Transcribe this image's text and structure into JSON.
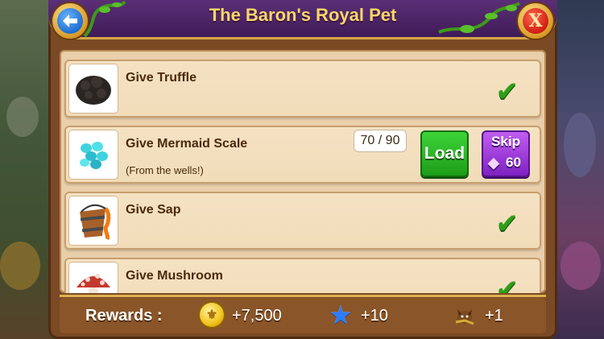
{
  "dialog": {
    "title": "The Baron's Royal Pet",
    "back_icon": "back-arrow-icon",
    "close_icon": "close-icon",
    "close_glyph": "X"
  },
  "tasks": [
    {
      "name": "Give Truffle",
      "icon": "truffle-icon",
      "status": "completed"
    },
    {
      "name": "Give Mermaid Scale",
      "hint": "(From the wells!)",
      "icon": "mermaid-scale-icon",
      "progress": "70 / 90",
      "status": "in-progress",
      "load_label": "Load",
      "skip_label": "Skip",
      "skip_cost": "60"
    },
    {
      "name": "Give Sap",
      "icon": "sap-bucket-icon",
      "status": "completed"
    },
    {
      "name": "Give Mushroom",
      "icon": "mushroom-icon",
      "status": "completed"
    }
  ],
  "rewards": {
    "label": "Rewards :",
    "coins": "+7,500",
    "xp": "+10",
    "item": "+1"
  },
  "colors": {
    "title_bar": "#4a2266",
    "check": "#2f9e17",
    "load_button": "#2ab527",
    "skip_button": "#a03ee0"
  }
}
